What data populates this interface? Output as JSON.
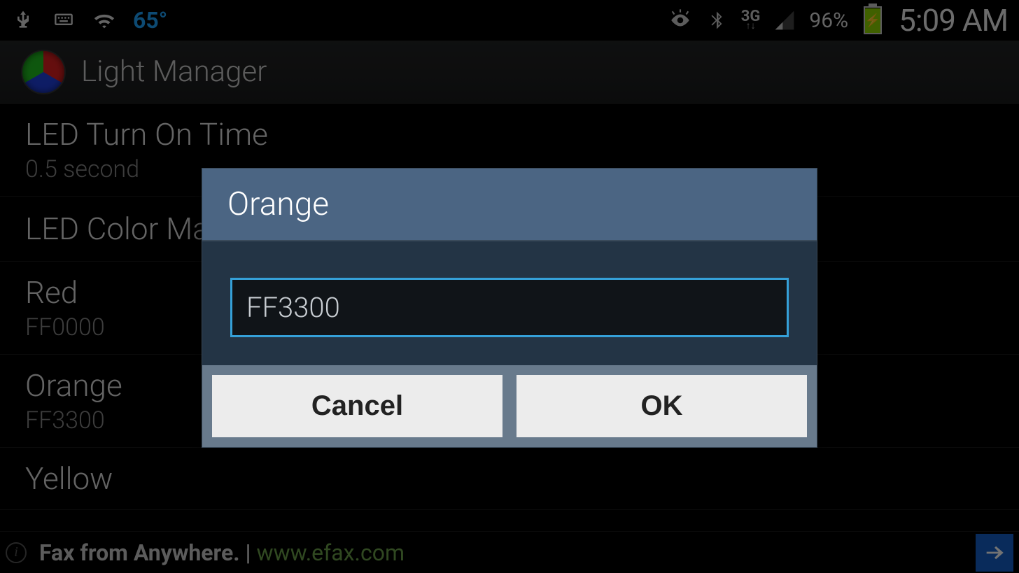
{
  "status_bar": {
    "temperature": "65°",
    "network_label": "3G",
    "battery_percent": "96%",
    "time": "5:09 AM"
  },
  "action_bar": {
    "title": "Light Manager"
  },
  "settings": {
    "led_on": {
      "title": "LED Turn On Time",
      "value": "0.5 second"
    },
    "section_color_map": "LED Color Map",
    "red": {
      "title": "Red",
      "value": "FF0000"
    },
    "orange": {
      "title": "Orange",
      "value": "FF3300"
    },
    "yellow": {
      "title": "Yellow",
      "value": ""
    }
  },
  "dialog": {
    "title": "Orange",
    "input_value": "FF3300",
    "cancel": "Cancel",
    "ok": "OK"
  },
  "ad": {
    "text": "Fax from Anywhere. | ",
    "link": "www.efax.com"
  }
}
